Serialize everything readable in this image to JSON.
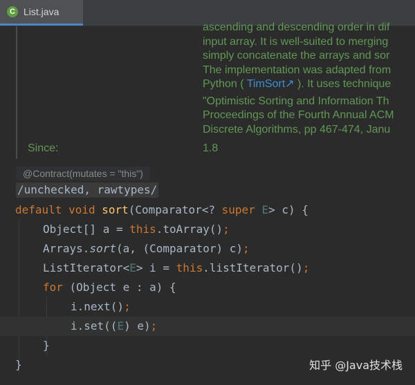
{
  "tab": {
    "icon": "java-class-icon",
    "icon_letter": "C",
    "title": "List.java"
  },
  "doc": {
    "lines": [
      "ascending and descending order in dif",
      "input array. It is well-suited to merging",
      "simply concatenate the arrays and sor",
      "The implementation was adapted from",
      "Python (",
      "TimSort",
      "). It uses technique",
      "\"Optimistic Sorting and Information Th",
      "Proceedings of the Fourth Annual ACM",
      "Discrete Algorithms, pp 467-474, Janu"
    ],
    "since_label": "Since:",
    "since_value": "1.8"
  },
  "annotation": {
    "contract": "@Contract(mutates = \"this\")",
    "suppress": "/unchecked, rawtypes/"
  },
  "code": {
    "l1_default": "default",
    "l1_void": "void",
    "l1_method": "sort",
    "l1_a": "(Comparator<? ",
    "l1_super": "super",
    "l1_e": "E",
    "l1_b": "> c) {",
    "l2_a": "Object[] a = ",
    "l2_this": "this",
    "l2_b": ".toArray()",
    "l2_semi": ";",
    "l3_a": "Arrays.",
    "l3_sort": "sort",
    "l3_b": "(a, (Comparator) c)",
    "l3_semi": ";",
    "l4_a": "ListIterator<",
    "l4_e": "E",
    "l4_b": "> i = ",
    "l4_this": "this",
    "l4_c": ".listIterator()",
    "l4_semi": ";",
    "l5_for": "for",
    "l5_a": " (Object e : a) {",
    "l6_a": "i.next()",
    "l6_semi": ";",
    "l7_a": "i.set((",
    "l7_e": "E",
    "l7_b": ") e)",
    "l7_semi": ";",
    "l8": "}",
    "l9": "}"
  },
  "watermark": "知乎 @Java技术栈",
  "colors": {
    "keyword": "#cc7832",
    "method": "#ffc66d",
    "generic": "#507874",
    "doc": "#629755",
    "link": "#3d8fd1"
  }
}
